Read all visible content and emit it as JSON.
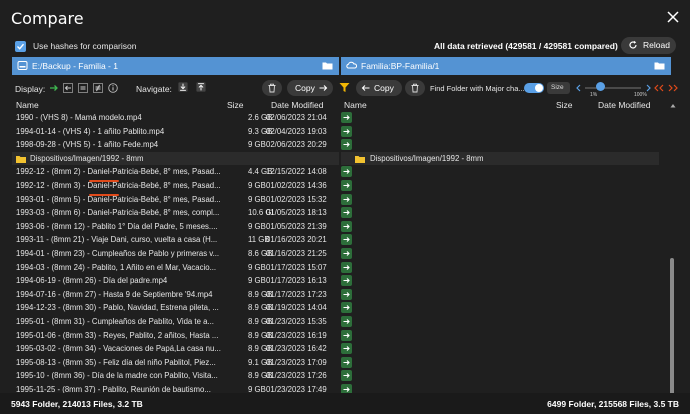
{
  "window": {
    "title": "Compare"
  },
  "options": {
    "use_hashes_label": "Use hashes for comparison",
    "status": "All data retrieved (429581 / 429581 compared)",
    "reload_label": "Reload"
  },
  "paths": {
    "left": "E:/Backup - Familia - 1",
    "right": "Familia:BP-Familia/1"
  },
  "toolbar": {
    "display_label": "Display:",
    "navigate_label": "Navigate:",
    "copy_right_label": "Copy",
    "copy_left_label": "Copy",
    "find_label": "Find Folder with Major cha...",
    "size_chip": "Size",
    "slider_min": "1%",
    "slider_max": "100%"
  },
  "columns": {
    "left": {
      "name": "Name",
      "size": "Size",
      "date": "Date Modified"
    },
    "right": {
      "name": "Name",
      "size": "Size",
      "date": "Date Modified"
    }
  },
  "rows": [
    {
      "type": "file",
      "name": "1990 - (VHS 8) - Mamá modelo.mp4",
      "size": "2.6 GB",
      "date": "02/06/2023 21:04"
    },
    {
      "type": "file",
      "name": "1994-01-14 - (VHS 4) - 1 añito Pablito.mp4",
      "size": "9.3 GB",
      "date": "02/04/2023 19:03"
    },
    {
      "type": "file",
      "name": "1998-09-28 - (VHS 5) - 1 añito Fede.mp4",
      "size": "9 GB",
      "date": "02/06/2023 20:29"
    },
    {
      "type": "folder",
      "name": "Dispositivos/Imagen/1992 - 8mm",
      "right_name": "Dispositivos/Imagen/1992 - 8mm"
    },
    {
      "type": "file",
      "name": "1992-12 - (8mm 2) - Daniel-Patricia-Bebé, 8° mes, Pasad...",
      "size": "4.4 GB",
      "date": "12/15/2022 14:08"
    },
    {
      "type": "file",
      "name": "1992-12 - (8mm 3) - Daniel-Patricia-Bebé, 8° mes, Pasad...",
      "size": "9 GB",
      "date": "01/02/2023 14:36"
    },
    {
      "type": "file",
      "name": "1993-01 - (8mm 5) - Daniel-Patricia-Bebé, 8° mes, Pasad...",
      "size": "9 GB",
      "date": "01/02/2023 15:32"
    },
    {
      "type": "file",
      "name": "1993-03 - (8mm 6) - Daniel-Patricia-Bebé, 8° mes, compl...",
      "size": "10.6 GB",
      "date": "01/05/2023 18:13"
    },
    {
      "type": "file",
      "name": "1993-06 - (8mm 12) - Pablito 1° Día del Padre, 5 meses....",
      "size": "9 GB",
      "date": "01/05/2023 21:39"
    },
    {
      "type": "file",
      "name": "1993-11 - (8mm 21) - Viaje Dani, curso, vuelta a casa (H...",
      "size": "11 GB",
      "date": "01/16/2023 20:21"
    },
    {
      "type": "file",
      "name": "1994-01 - (8mm 23) - Cumpleaños de Pablo y primeras v...",
      "size": "8.6 GB",
      "date": "01/16/2023 21:25"
    },
    {
      "type": "file",
      "name": "1994-03 - (8mm 24) - Pablito, 1 Añito en el Mar, Vacacio...",
      "size": "9 GB",
      "date": "01/17/2023 15:07"
    },
    {
      "type": "file",
      "name": "1994-06-19 - (8mm 26) - Día del padre.mp4",
      "size": "9 GB",
      "date": "01/17/2023 16:13"
    },
    {
      "type": "file",
      "name": "1994-07-16 - (8mm 27) - Hasta 9 de Septiembre '94.mp4",
      "size": "8.9 GB",
      "date": "01/17/2023 17:23"
    },
    {
      "type": "file",
      "name": "1994-12-23 - (8mm 30) - Pablo, Navidad, Estrena pileta, ...",
      "size": "8.9 GB",
      "date": "01/19/2023 14:04"
    },
    {
      "type": "file",
      "name": "1995-01 - (8mm 31) - Cumpleaños de Pablito, Vida te a...",
      "size": "8.9 GB",
      "date": "01/23/2023 15:35"
    },
    {
      "type": "file",
      "name": "1995-01-06 - (8mm 33) - Reyes, Pablito, 2 añitos, Hasta ...",
      "size": "8.9 GB",
      "date": "01/23/2023 16:19"
    },
    {
      "type": "file",
      "name": "1995-03-02 - (8mm 34) - Vacaciones de Papá,La casa nu...",
      "size": "8.9 GB",
      "date": "01/23/2023 16:42"
    },
    {
      "type": "file",
      "name": "1995-08-13 - (8mm 35) - Feliz día del niño Pablitol, Piez...",
      "size": "9.1 GB",
      "date": "01/23/2023 17:09"
    },
    {
      "type": "file",
      "name": "1995-10 - (8mm 36) - Día de la madre con Pablito, Visita...",
      "size": "8.9 GB",
      "date": "01/23/2023 17:26"
    },
    {
      "type": "file",
      "name": "1995-11-25 - (8mm 37) - Pablito, Reunión de bautismo...",
      "size": "9 GB",
      "date": "01/23/2023 17:49"
    }
  ],
  "footer": {
    "left": "5943 Folder, 214013 Files, 3.2 TB",
    "right": "6499 Folder, 215568 Files, 3.5 TB"
  },
  "colors": {
    "background": "#1f1f1f",
    "path_bar": "#5493d3",
    "accent": "#5aa0e6",
    "filter_yellow": "#f2b705",
    "nav_red": "#e04a1a",
    "folder_yellow": "#f2c230",
    "copy_arrow_green": "#2d6e3a"
  }
}
